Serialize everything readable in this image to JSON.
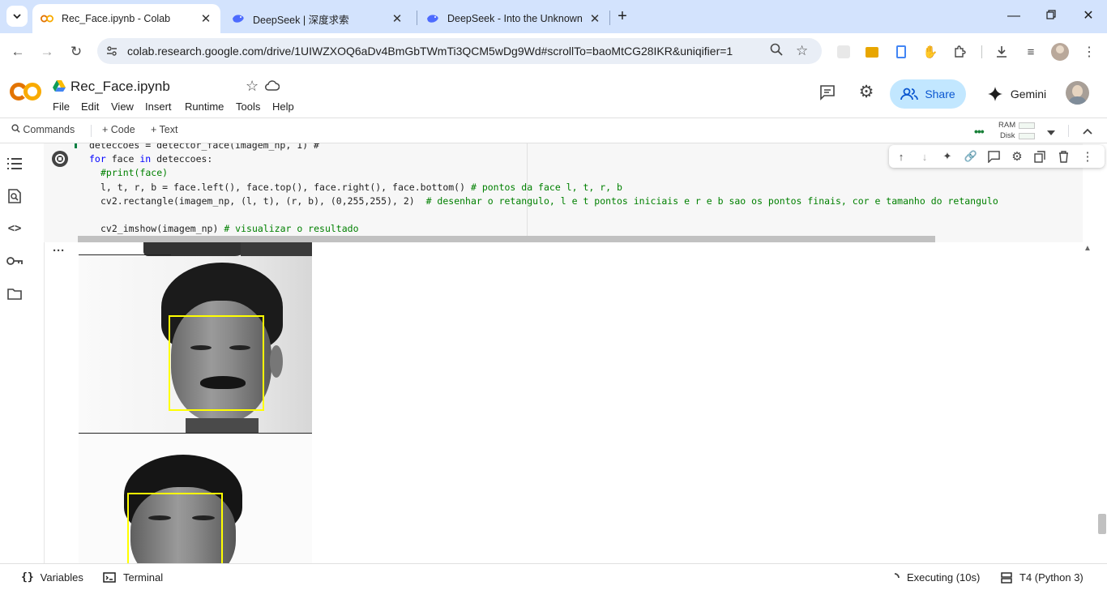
{
  "browser": {
    "tabs": [
      {
        "title": "Rec_Face.ipynb - Colab",
        "active": true
      },
      {
        "title": "DeepSeek | 深度求索",
        "active": false
      },
      {
        "title": "DeepSeek - Into the Unknown",
        "active": false
      }
    ],
    "new_tab_icon": "plus-icon",
    "url": "colab.research.google.com/drive/1UIWZXOQ6aDv4BmGbTWmTi3QCM5wDg9Wd#scrollTo=baoMtCG28IKR&uniqifier=1"
  },
  "colab": {
    "logo": "CO",
    "notebook_title": "Rec_Face.ipynb",
    "menu": [
      "File",
      "Edit",
      "View",
      "Insert",
      "Runtime",
      "Tools",
      "Help"
    ],
    "share_label": "Share",
    "gemini_label": "Gemini",
    "toolbar": {
      "commands": "Commands",
      "add_code": "Code",
      "add_text": "Text",
      "ram_label": "RAM",
      "disk_label": "Disk"
    }
  },
  "code": {
    "line0": "deteccoes = detector_face(imagem_np, 1) #",
    "line1_kw": "for",
    "line1_a": " face ",
    "line1_in": "in",
    "line1_b": " deteccoes:",
    "line2": "#print(face)",
    "line3_code": "l, t, r, b = face.left(), face.top(), face.right(), face.bottom() ",
    "line3_comment": "# pontos da face l, t, r, b",
    "line4_code": "cv2.rectangle(imagem_np, (l, t), (r, b), (0,255,255), 2)  ",
    "line4_comment": "# desenhar o retangulo, l e t pontos iniciais e r e b sao os pontos finais, cor e tamanho do retangulo",
    "line6_code": "cv2_imshow(imagem_np) ",
    "line6_comment": "# visualizar o resultado"
  },
  "statusbar": {
    "variables": "Variables",
    "terminal": "Terminal",
    "executing": "Executing (10s)",
    "runtime": "T4 (Python 3)"
  },
  "colors": {
    "tabstrip": "#d3e3fd",
    "share_bg": "#c2e7ff",
    "face_box": "#ffff00",
    "colab_orange": "#f9ab00"
  }
}
